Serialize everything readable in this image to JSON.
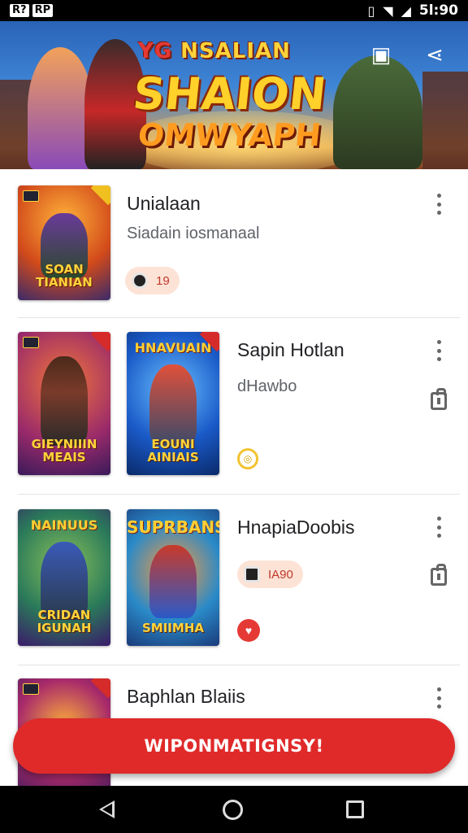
{
  "status_bar": {
    "left_icons": [
      "R?",
      "RP"
    ],
    "time": "5l:90"
  },
  "banner": {
    "title_small": "NSALIAN",
    "title_small_logo": "YG",
    "title_line1": "SHAION",
    "title_line2": "OMWYAPH"
  },
  "items": [
    {
      "title": "Unialaan",
      "subtitle": "Siadain iosmanaal",
      "chip_text": "19",
      "thumb1_caption": "SOAN TIANIAN"
    },
    {
      "title": "Sapin Hotlan",
      "subtitle": "dHawbo",
      "thumb1_caption": "GIEYNIIIN MEAIS",
      "thumb2_top": "HNAVUAIN",
      "thumb2_caption": "EOUNI AINIAIS"
    },
    {
      "title": "HnapiaDoobis",
      "chip_text": "IA90",
      "thumb1_top": "NAINUUS",
      "thumb1_caption": "CRIDAN IGUNAH",
      "thumb2_top": "SUPRBANS",
      "thumb2_caption": "SMIIMHA"
    },
    {
      "title": "Baphlan Blaiis"
    }
  ],
  "fab_label": "WIPONMATIGNSY!",
  "colors": {
    "accent": "#e02a2a",
    "chip_bg": "#fde3d6"
  }
}
